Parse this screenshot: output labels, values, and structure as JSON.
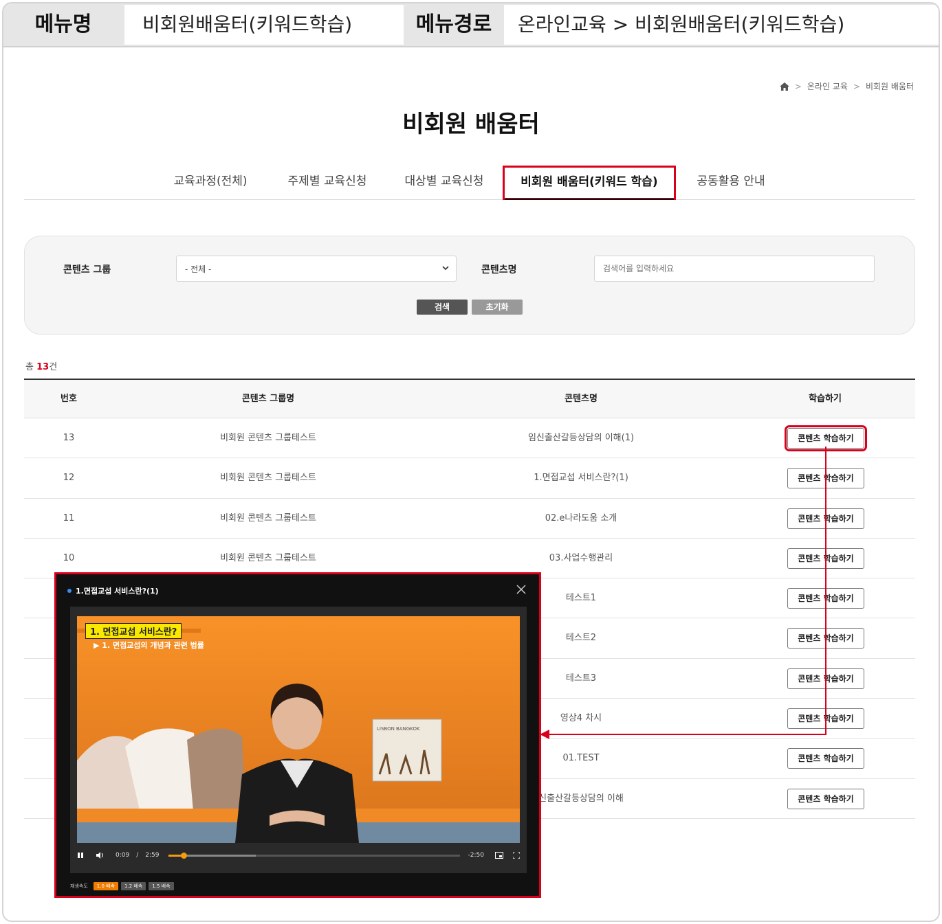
{
  "header": {
    "menu_name_label": "메뉴명",
    "menu_name_value": "비회원배움터(키워드학습)",
    "menu_path_label": "메뉴경로",
    "menu_path_value": "온라인교육 > 비회원배움터(키워드학습)"
  },
  "breadcrumb": {
    "home_icon": "home-icon",
    "sep": ">",
    "items": [
      "온라인 교육",
      "비회원 배움터"
    ]
  },
  "page_title": "비회원 배움터",
  "tabs": [
    "교육과정(전체)",
    "주제별 교육신청",
    "대상별 교육신청",
    "비회원 배움터(키워드 학습)",
    "공동활용 안내"
  ],
  "search": {
    "group_label": "콘텐츠 그룹",
    "group_value": "- 전체 -",
    "name_label": "콘텐츠명",
    "name_placeholder": "검색어를 입력하세요",
    "search_btn": "검색",
    "reset_btn": "초기화"
  },
  "total": {
    "prefix": "총 ",
    "count": "13",
    "suffix": "건"
  },
  "table": {
    "headers": [
      "번호",
      "콘텐츠 그룹명",
      "콘텐츠명",
      "학습하기"
    ],
    "button_label": "콘텐츠 학습하기",
    "rows": [
      {
        "no": "13",
        "group": "비회원 콘텐츠 그룹테스트",
        "name": "임신출산갈등상담의 이해(1)"
      },
      {
        "no": "12",
        "group": "비회원 콘텐츠 그룹테스트",
        "name": "1.면접교섭 서비스란?(1)"
      },
      {
        "no": "11",
        "group": "비회원 콘텐츠 그룹테스트",
        "name": "02.e나라도움 소개"
      },
      {
        "no": "10",
        "group": "비회원 콘텐츠 그룹테스트",
        "name": "03.사업수행관리"
      },
      {
        "no": "",
        "group": "",
        "name": "테스트1"
      },
      {
        "no": "",
        "group": "",
        "name": "테스트2"
      },
      {
        "no": "",
        "group": "",
        "name": "테스트3"
      },
      {
        "no": "",
        "group": "",
        "name": "영상4 차시"
      },
      {
        "no": "",
        "group": "",
        "name": "01.TEST"
      },
      {
        "no": "",
        "group": "",
        "name": "신출산갈등상담의 이해"
      }
    ]
  },
  "popup": {
    "title": "1.면접교섭 서비스란?(1)",
    "slide_title": "1. 면접교섭 서비스란?",
    "slide_sub": "▶ 1. 면접교섭의 개념과 관련 법률",
    "sign_text": "LISBON  BANGKOK",
    "current_time": "0:09",
    "time_sep": "/",
    "duration": "2:59",
    "remaining": "-2:50",
    "progress_fraction": 0.05,
    "speed_label": "재생속도",
    "speeds": [
      "1.0 배속",
      "1.2 배속",
      "1.5 배속"
    ]
  },
  "colors": {
    "accent_red": "#d8001b",
    "progress": "#f39c12",
    "speed_active": "#f07c00"
  }
}
